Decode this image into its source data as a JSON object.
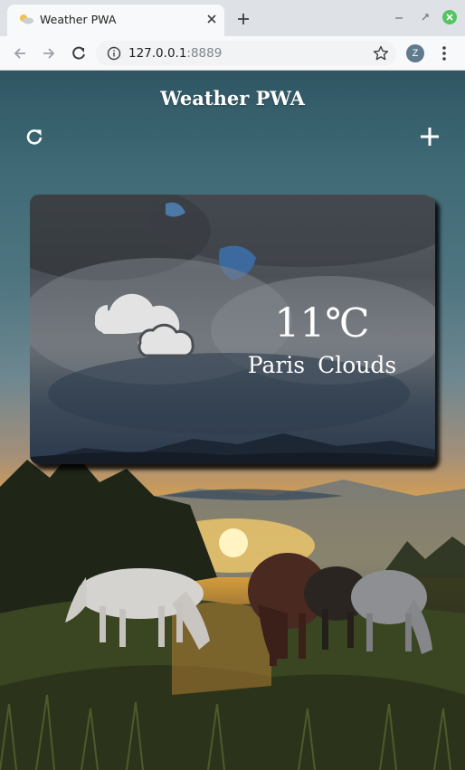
{
  "browser": {
    "tab": {
      "title": "Weather PWA",
      "favicon": "weather-favicon-icon"
    },
    "new_tab_icon": "plus-icon",
    "window_controls": [
      "minimize-icon",
      "maximize-icon",
      "close-icon"
    ],
    "address_bar": {
      "host": "127.0.0.1",
      "port": ":8889"
    },
    "profile_initial": "Z"
  },
  "app": {
    "title": "Weather PWA",
    "refresh_icon": "refresh-icon",
    "add_icon": "plus-icon"
  },
  "weather_card": {
    "temperature": "11℃",
    "city": "Paris",
    "condition": "Clouds",
    "icon": "clouds-icon"
  },
  "colors": {
    "text": "#ffffff",
    "close_button": "#55c561",
    "card_shadow": "#000000"
  }
}
